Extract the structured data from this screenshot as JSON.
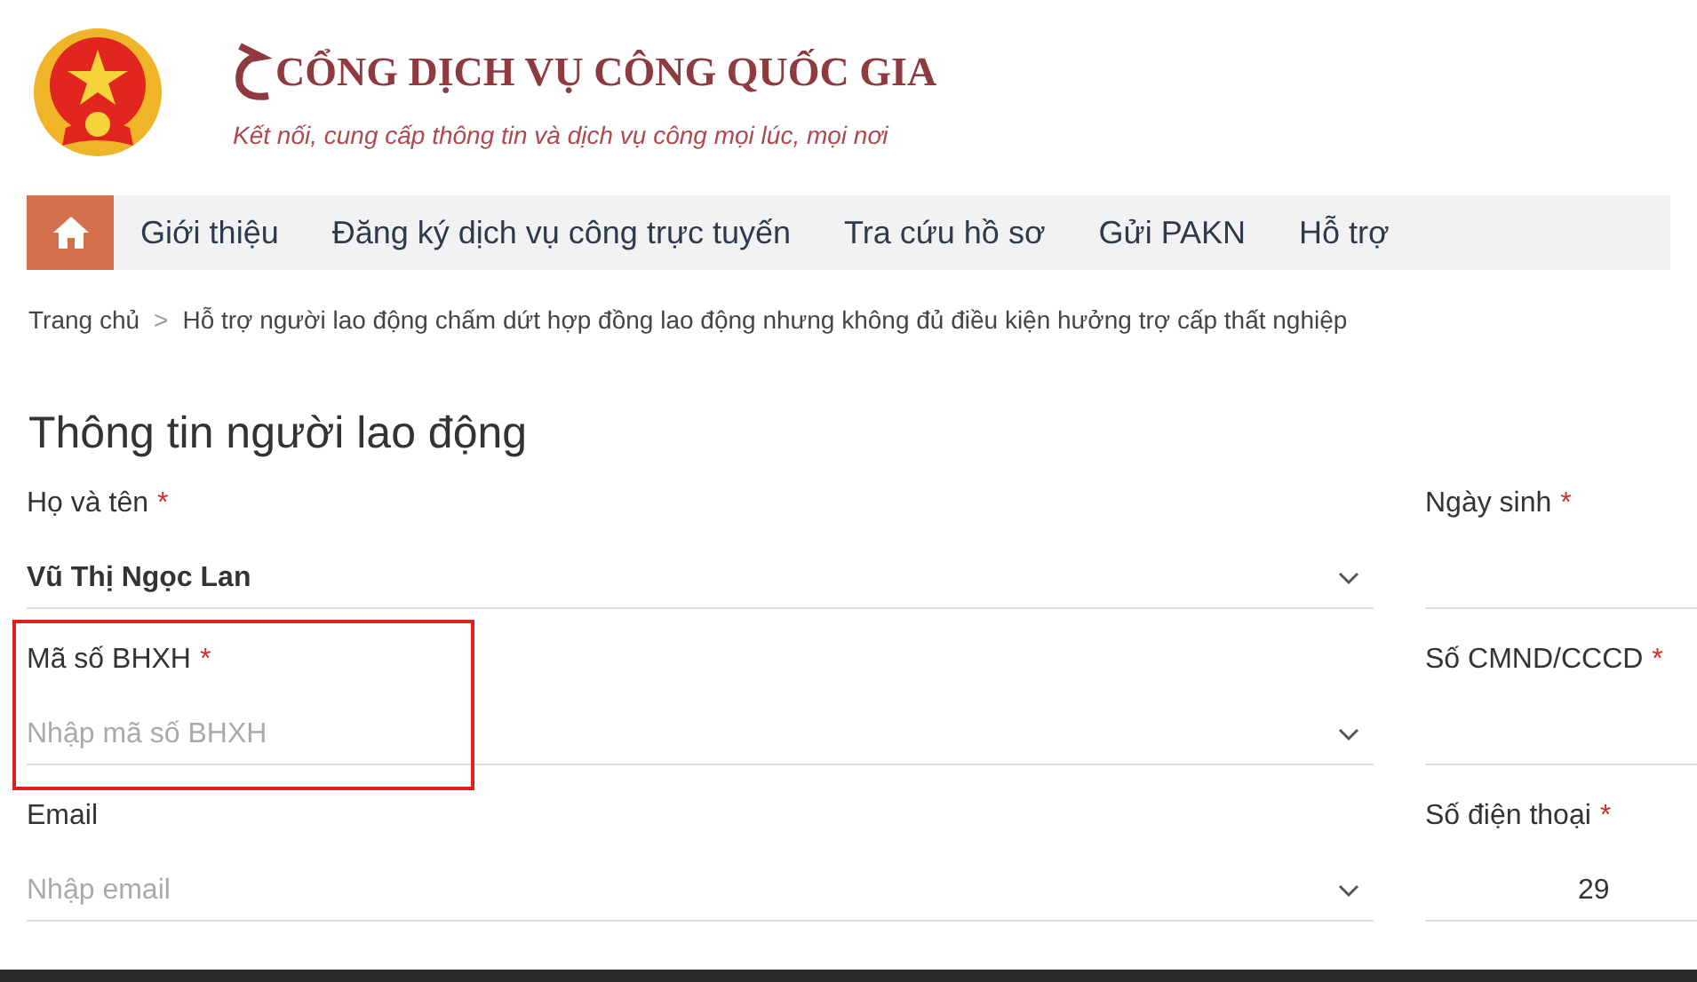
{
  "header": {
    "title": "CỔNG DỊCH VỤ CÔNG QUỐC GIA",
    "slogan": "Kết nối, cung cấp thông tin và dịch vụ công mọi lúc, mọi nơi"
  },
  "nav": [
    {
      "kind": "home",
      "selected": true
    },
    {
      "kind": "link",
      "label": "Giới thiệu",
      "selected": false
    },
    {
      "kind": "link",
      "label": "Đăng ký dịch vụ công trực tuyến",
      "selected": false
    },
    {
      "kind": "link",
      "label": "Tra cứu hồ sơ",
      "selected": false
    },
    {
      "kind": "link",
      "label": "Gửi PAKN",
      "selected": false
    },
    {
      "kind": "link",
      "label": "Hỗ trợ",
      "selected": false
    }
  ],
  "breadcrumb": {
    "separator": ">",
    "items": [
      "Trang chủ",
      "Hỗ trợ người lao động chấm dứt hợp đồng lao động nhưng không đủ điều kiện hưởng trợ cấp thất nghiệp"
    ]
  },
  "section_title": "Thông tin người lao động",
  "required_mark": "*",
  "rows": [
    {
      "left": {
        "label": "Họ và tên",
        "required": true,
        "value": "Vũ Thị Ngọc Lan",
        "highlighted": false
      },
      "right": {
        "label": "Ngày sinh",
        "required": true
      }
    },
    {
      "left": {
        "label": "Mã số BHXH",
        "required": true,
        "placeholder": "Nhập mã số BHXH",
        "highlighted": true
      },
      "right": {
        "label": "Số CMND/CCCD",
        "required": true
      }
    },
    {
      "left": {
        "label": "Email",
        "required": false,
        "placeholder": "Nhập email",
        "highlighted": false
      },
      "right": {
        "label": "Số điện thoại",
        "required": true,
        "value": "29"
      }
    }
  ]
}
